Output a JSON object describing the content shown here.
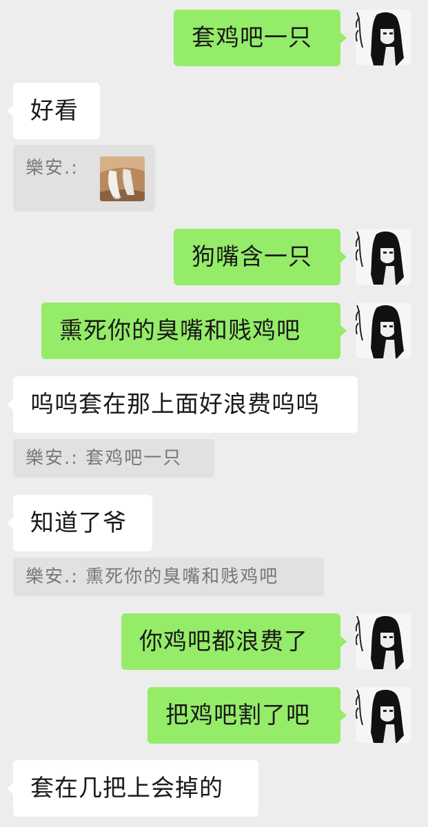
{
  "messages": [
    {
      "side": "out",
      "text": "套鸡吧一只"
    },
    {
      "side": "in",
      "text": "好看"
    },
    {
      "side": "quote",
      "sender": "樂安.:",
      "text": "",
      "image": "photo-feet-in-white-socks"
    },
    {
      "side": "out",
      "text": "狗嘴含一只"
    },
    {
      "side": "out",
      "text": "熏死你的臭嘴和贱鸡吧"
    },
    {
      "side": "in",
      "text": "呜呜套在那上面好浪费呜呜"
    },
    {
      "side": "quote",
      "sender": "樂安.:",
      "text": "套鸡吧一只"
    },
    {
      "side": "in",
      "text": "知道了爷"
    },
    {
      "side": "quote",
      "sender": "樂安.:",
      "text": "熏死你的臭嘴和贱鸡吧"
    },
    {
      "side": "out",
      "text": "你鸡吧都浪费了"
    },
    {
      "side": "out",
      "text": "把鸡吧割了吧"
    },
    {
      "side": "in",
      "text": "套在几把上会掉的"
    }
  ],
  "colors": {
    "background": "#ededed",
    "outgoing_bubble": "#95ec69",
    "incoming_bubble": "#ffffff",
    "quote_bubble": "#e1e1e1",
    "quote_text": "#777777"
  },
  "icons": {
    "avatar": "anime-girl-avatar-icon",
    "quote_image": "photo-thumbnail-icon"
  }
}
